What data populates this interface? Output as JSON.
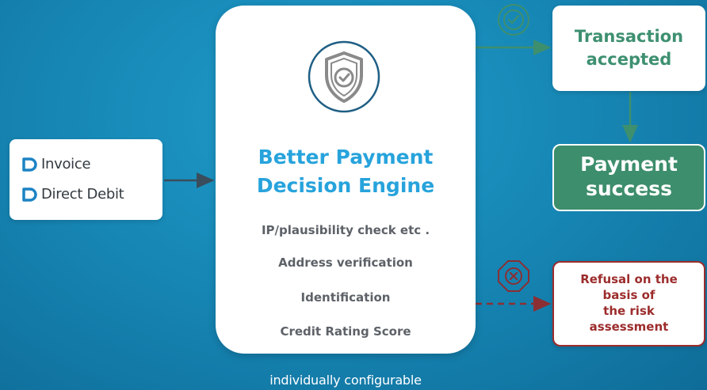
{
  "payment_methods": {
    "items": [
      {
        "label": "Invoice",
        "icon": "brand-d-icon"
      },
      {
        "label": "Direct Debit",
        "icon": "brand-d-icon"
      }
    ]
  },
  "engine": {
    "icon": "shield-check-icon",
    "title_line1": "Better Payment",
    "title_line2": "Decision Engine",
    "checks": [
      "IP/plausibility check etc .",
      "Address verification",
      "Identification",
      "Credit Rating Score"
    ]
  },
  "outcomes": {
    "accepted": {
      "line1": "Transaction",
      "line2": "accepted",
      "icon": "check-circle-icon"
    },
    "success": {
      "line1": "Payment",
      "line2": "success"
    },
    "refusal": {
      "lines": [
        "Refusal on the",
        "basis of",
        "the risk",
        "assessment"
      ],
      "icon": "x-octagon-icon"
    }
  },
  "footer": {
    "note": "individually configurable"
  },
  "colors": {
    "background": "#1788b6",
    "engine_title": "#27a3dc",
    "accept_green": "#3e9071",
    "success_fill": "#3d8e6c",
    "refusal_red": "#9c2c2c",
    "check_text": "#5d6268"
  }
}
